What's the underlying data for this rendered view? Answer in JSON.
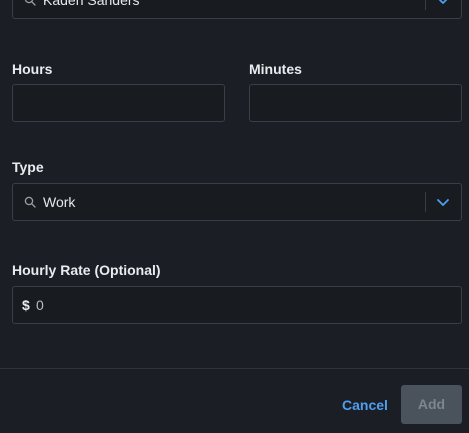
{
  "employee": {
    "value": "Kaden Sanders"
  },
  "hours": {
    "label": "Hours",
    "value": ""
  },
  "minutes": {
    "label": "Minutes",
    "value": ""
  },
  "type": {
    "label": "Type",
    "value": "Work"
  },
  "hourly_rate": {
    "label": "Hourly Rate (Optional)",
    "currency": "$",
    "placeholder": "0"
  },
  "footer": {
    "cancel_label": "Cancel",
    "add_label": "Add"
  },
  "colors": {
    "accent": "#4e9ef0",
    "disabled_button": "#4a525c",
    "background": "#1b1f25"
  }
}
